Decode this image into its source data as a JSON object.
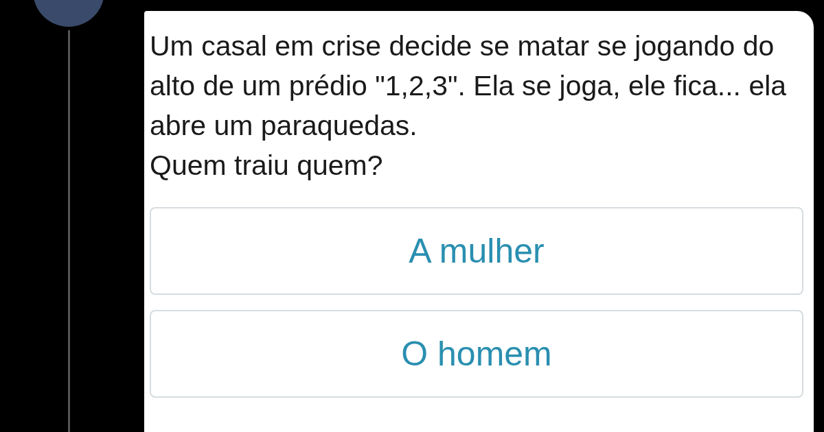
{
  "post": {
    "text": "Um casal em crise decide se matar se jogando do alto de um prédio \"1,2,3\". Ela se joga, ele fica... ela abre um paraquedas.",
    "question": "Quem traiu quem?"
  },
  "options": [
    {
      "label": "A mulher"
    },
    {
      "label": "O homem"
    }
  ]
}
